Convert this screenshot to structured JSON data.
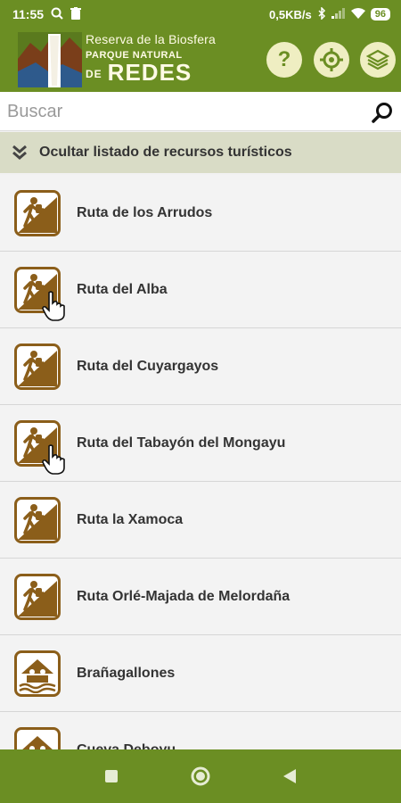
{
  "status_bar": {
    "time": "11:55",
    "net_speed": "0,5KB/s",
    "battery": "96"
  },
  "header": {
    "brand_line1": "Reserva de la Biosfera",
    "brand_line2": "PARQUE NATURAL",
    "brand_line3_prefix": "DE",
    "brand_line3": "REDES",
    "help_label": "?"
  },
  "search": {
    "placeholder": "Buscar"
  },
  "toggle": {
    "label": "Ocultar listado de recursos turísticos"
  },
  "list": {
    "items": [
      {
        "name": "Ruta de los Arrudos",
        "icon": "hiker-icon"
      },
      {
        "name": "Ruta del Alba",
        "icon": "hiker-icon"
      },
      {
        "name": "Ruta del Cuyargayos",
        "icon": "hiker-icon"
      },
      {
        "name": "Ruta del Tabayón del Mongayu",
        "icon": "hiker-icon"
      },
      {
        "name": "Ruta la Xamoca",
        "icon": "hiker-icon"
      },
      {
        "name": "Ruta Orlé-Majada de Melordaña",
        "icon": "hiker-icon"
      },
      {
        "name": "Brañagallones",
        "icon": "refuge-icon"
      },
      {
        "name": "Cueva Deboyu",
        "icon": "refuge-icon"
      }
    ]
  },
  "colors": {
    "primary": "#6b8e23",
    "icon_border": "#8b5e1a",
    "toggle_bg": "#d9dcc6"
  }
}
